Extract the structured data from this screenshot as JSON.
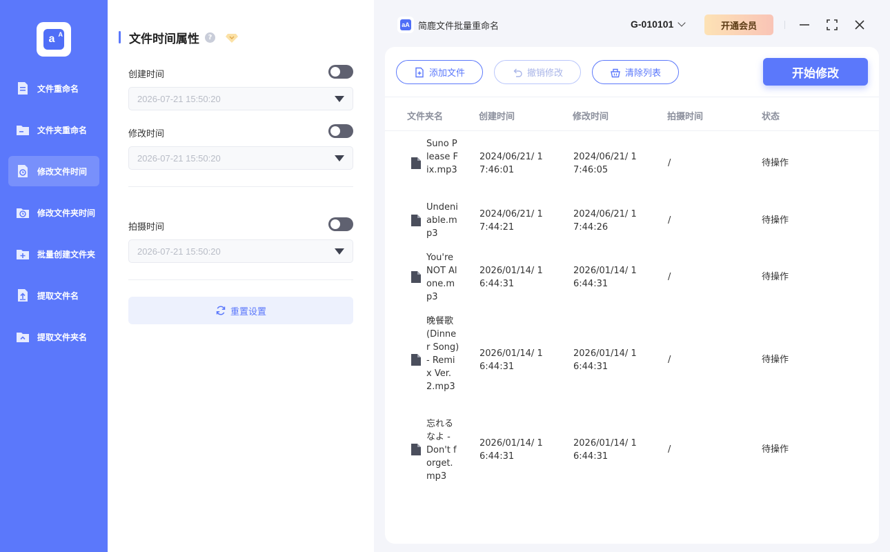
{
  "sidebar": {
    "items": [
      {
        "label": "文件重命名",
        "icon": "file-rename-icon",
        "active": false
      },
      {
        "label": "文件夹重命名",
        "icon": "folder-rename-icon",
        "active": false
      },
      {
        "label": "修改文件时间",
        "icon": "file-clock-icon",
        "active": true
      },
      {
        "label": "修改文件夹时间",
        "icon": "folder-clock-icon",
        "active": false
      },
      {
        "label": "批量创建文件夹",
        "icon": "folder-add-icon",
        "active": false
      },
      {
        "label": "提取文件名",
        "icon": "file-upload-icon",
        "active": false
      },
      {
        "label": "提取文件夹名",
        "icon": "folder-up-icon",
        "active": false
      }
    ]
  },
  "panel": {
    "title": "文件时间属性",
    "help": "?",
    "created_label": "创建时间",
    "created_value": "2026-07-21 15:50:20",
    "modified_label": "修改时间",
    "modified_value": "2026-07-21 15:50:20",
    "taken_label": "拍摄时间",
    "taken_value": "2026-07-21 15:50:20",
    "reset_label": "重置设置"
  },
  "topbar": {
    "app_title": "简鹿文件批量重命名",
    "account": "G-010101",
    "vip_label": "开通会员"
  },
  "toolbar": {
    "add_file": "添加文件",
    "undo": "撤销修改",
    "clear": "清除列表",
    "start": "开始修改"
  },
  "table": {
    "headers": [
      "文件夹名",
      "创建时间",
      "修改时间",
      "拍摄时间",
      "状态"
    ],
    "rows": [
      {
        "name": "Suno Please Fix.mp3",
        "created": "2024/06/21/ 17:46:01",
        "modified": "2024/06/21/ 17:46:05",
        "taken": "/",
        "status": "待操作"
      },
      {
        "name": "Undeniable.mp3",
        "created": "2024/06/21/ 17:44:21",
        "modified": "2024/06/21/ 17:44:26",
        "taken": "/",
        "status": "待操作"
      },
      {
        "name": "You're NOT Alone.mp3",
        "created": "2026/01/14/ 16:44:31",
        "modified": "2026/01/14/ 16:44:31",
        "taken": "/",
        "status": "待操作"
      },
      {
        "name": "晚餐歌(Dinner Song) - Remix Ver. 2.mp3",
        "created": "2026/01/14/ 16:44:31",
        "modified": "2026/01/14/ 16:44:31",
        "taken": "/",
        "status": "待操作"
      },
      {
        "name": "忘れるなよ - Don't forget.mp3",
        "created": "2026/01/14/ 16:44:31",
        "modified": "2026/01/14/ 16:44:31",
        "taken": "/",
        "status": "待操作"
      }
    ]
  },
  "colors": {
    "accent": "#5b78fb",
    "sidebar": "#5b78fb",
    "toggle_off": "#5f6170"
  }
}
